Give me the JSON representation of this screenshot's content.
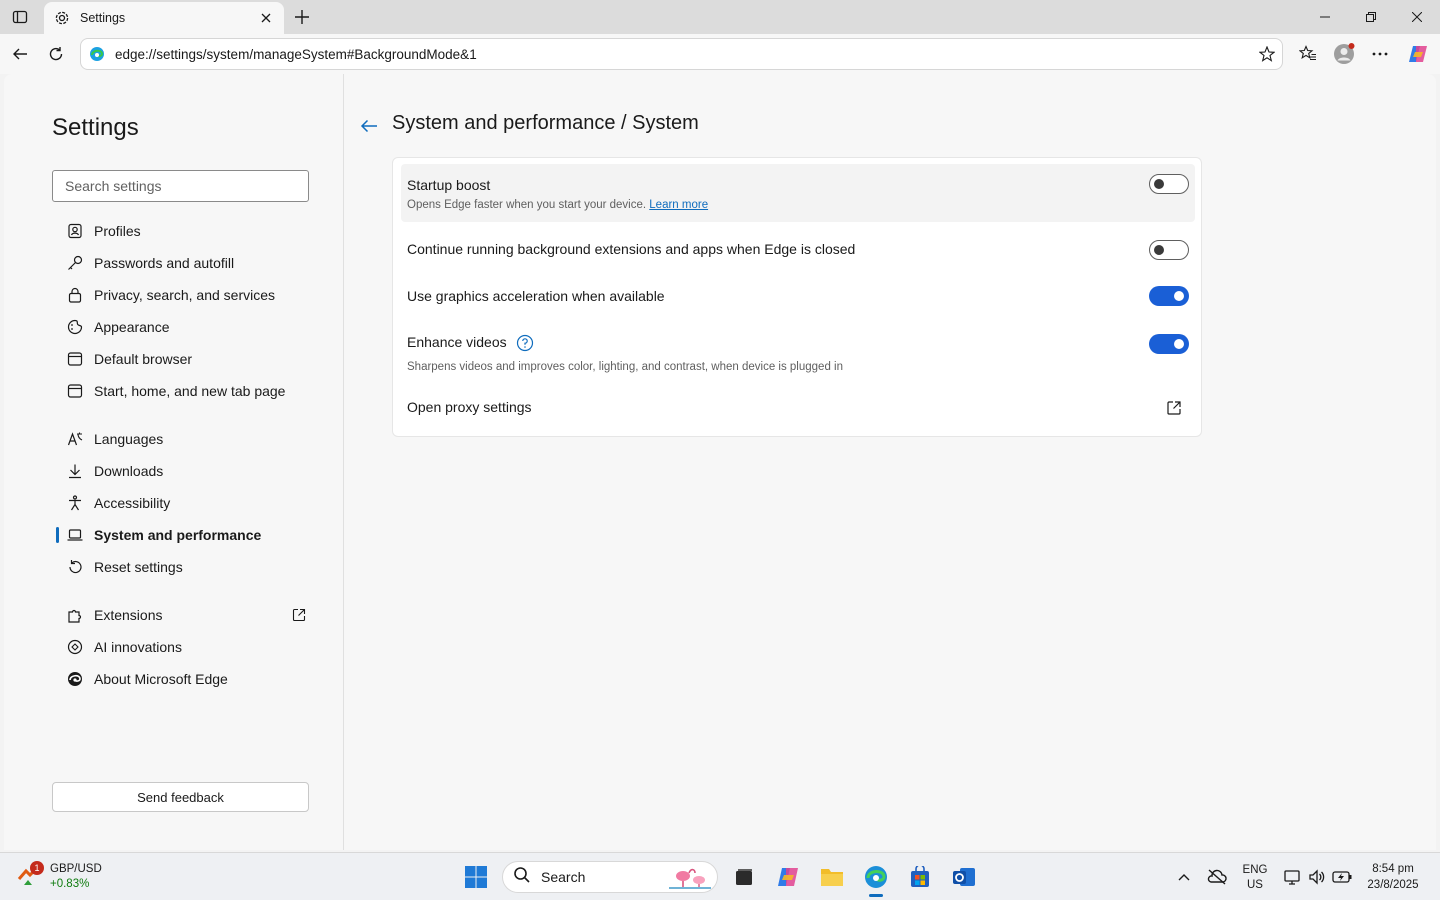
{
  "browser": {
    "tab_title": "Settings",
    "url": "edge://settings/system/manageSystem#BackgroundMode&1",
    "icons": [
      "tab-actions-icon",
      "gear-icon",
      "close-icon",
      "plus-icon",
      "minimize-icon",
      "restore-icon",
      "back-icon",
      "refresh-icon",
      "edge-icon",
      "star-icon",
      "favorites-icon",
      "profile-icon",
      "more-icon",
      "copilot-icon"
    ]
  },
  "sidebar": {
    "title": "Settings",
    "search_placeholder": "Search settings",
    "items": [
      {
        "label": "Profiles",
        "icon": "profile-icon"
      },
      {
        "label": "Passwords and autofill",
        "icon": "key-icon"
      },
      {
        "label": "Privacy, search, and services",
        "icon": "lock-icon"
      },
      {
        "label": "Appearance",
        "icon": "appearance-icon"
      },
      {
        "label": "Default browser",
        "icon": "browser-icon"
      },
      {
        "label": "Start, home, and new tab page",
        "icon": "home-icon"
      },
      {
        "label": "Languages",
        "icon": "languages-icon"
      },
      {
        "label": "Downloads",
        "icon": "download-icon"
      },
      {
        "label": "Accessibility",
        "icon": "accessibility-icon"
      },
      {
        "label": "System and performance",
        "icon": "laptop-icon",
        "active": true
      },
      {
        "label": "Reset settings",
        "icon": "reset-icon"
      },
      {
        "label": "Extensions",
        "icon": "extensions-icon"
      },
      {
        "label": "AI innovations",
        "icon": "ai-icon"
      },
      {
        "label": "About Microsoft Edge",
        "icon": "edge-icon"
      }
    ],
    "feedback_label": "Send feedback"
  },
  "main": {
    "title": "System and performance / System",
    "rows": [
      {
        "label": "Startup boost",
        "desc": "Opens Edge faster when you start your device.",
        "link": "Learn more",
        "toggle": "off"
      },
      {
        "label": "Continue running background extensions and apps when Edge is closed",
        "toggle": "off"
      },
      {
        "label": "Use graphics acceleration when available",
        "toggle": "on"
      },
      {
        "label": "Enhance videos",
        "desc": "Sharpens videos and improves color, lighting, and contrast, when device is plugged in",
        "toggle": "on"
      },
      {
        "label": "Open proxy settings"
      }
    ]
  },
  "taskbar": {
    "widget_title": "GBP/USD",
    "widget_change": "+0.83%",
    "widget_badge": "1",
    "search_label": "Search",
    "lang_line1": "ENG",
    "lang_line2": "US",
    "time": "8:54 pm",
    "date": "23/8/2025"
  },
  "colors": {
    "accent": "#1a5fd6",
    "active_bar": "#0f6cbd",
    "positive": "#107c10"
  }
}
